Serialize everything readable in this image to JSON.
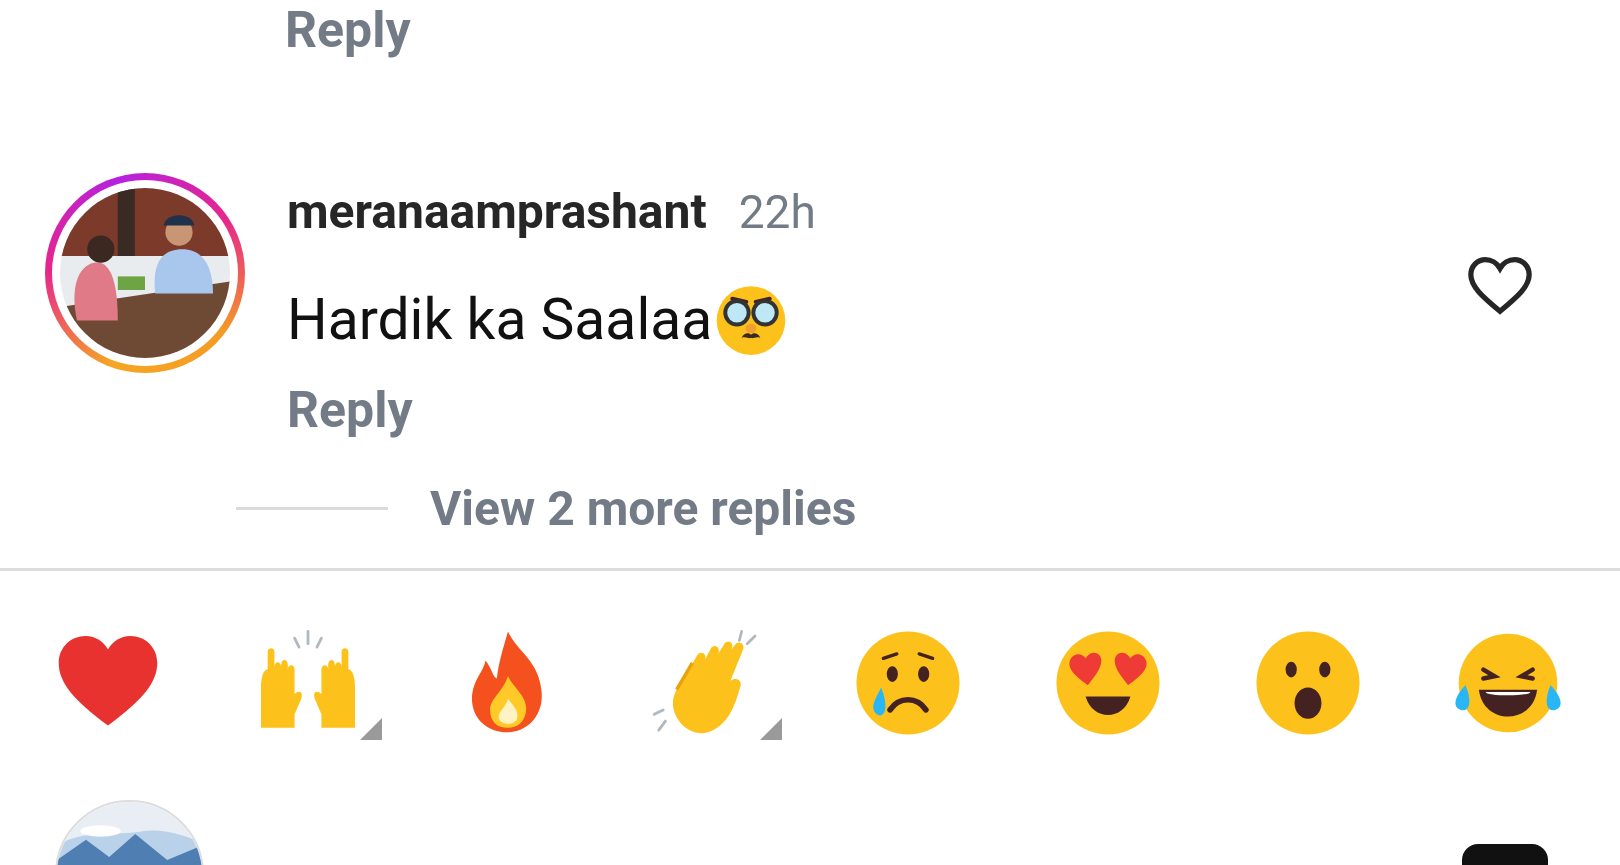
{
  "previous_comment": {
    "reply_label": "Reply"
  },
  "comment": {
    "username": "meranaamprashant",
    "time": "22h",
    "text": "Hardik ka Saalaa",
    "reply_label": "Reply",
    "liked": false
  },
  "view_replies": {
    "label": "View 2 more replies"
  },
  "reactions": [
    {
      "kind": "heart",
      "skin_tone_options": false
    },
    {
      "kind": "raised-hands",
      "skin_tone_options": true
    },
    {
      "kind": "fire",
      "skin_tone_options": false
    },
    {
      "kind": "clap",
      "skin_tone_options": true
    },
    {
      "kind": "crying",
      "skin_tone_options": false
    },
    {
      "kind": "heart-eyes",
      "skin_tone_options": false
    },
    {
      "kind": "surprised",
      "skin_tone_options": false
    },
    {
      "kind": "laughing",
      "skin_tone_options": false
    }
  ]
}
